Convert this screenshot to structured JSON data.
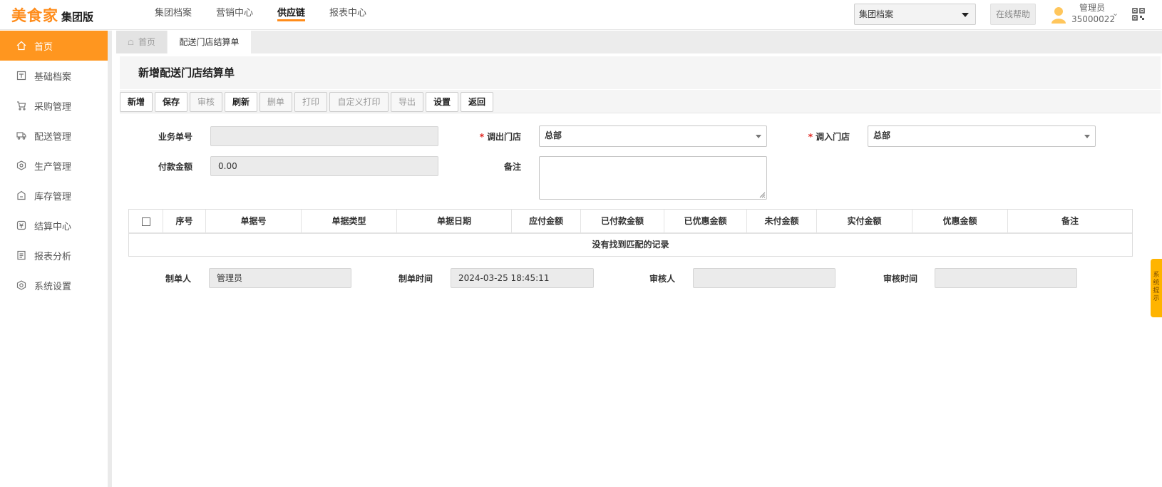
{
  "header": {
    "brand": "美食家",
    "edition": "集团版",
    "nav": [
      "集团档案",
      "营销中心",
      "供应链",
      "报表中心"
    ],
    "active_nav": "供应链",
    "org_select": "集团档案",
    "help": "在线帮助",
    "user_role": "管理员",
    "user_id": "35000022"
  },
  "sidebar": {
    "items": [
      {
        "label": "首页",
        "icon": "home-icon"
      },
      {
        "label": "基础档案",
        "icon": "archive-icon"
      },
      {
        "label": "采购管理",
        "icon": "cart-icon"
      },
      {
        "label": "配送管理",
        "icon": "truck-icon"
      },
      {
        "label": "生产管理",
        "icon": "production-icon"
      },
      {
        "label": "库存管理",
        "icon": "inventory-icon"
      },
      {
        "label": "结算中心",
        "icon": "settlement-icon"
      },
      {
        "label": "报表分析",
        "icon": "report-icon"
      },
      {
        "label": "系统设置",
        "icon": "settings-icon"
      }
    ],
    "active": "首页"
  },
  "tabs": {
    "home": "首页",
    "current": "配送门店结算单"
  },
  "page": {
    "title": "新增配送门店结算单",
    "toolbar": [
      "新增",
      "保存",
      "审核",
      "刷新",
      "删单",
      "打印",
      "自定义打印",
      "导出",
      "设置",
      "返回"
    ],
    "toolbar_disabled": [
      "审核",
      "删单",
      "打印",
      "自定义打印",
      "导出"
    ]
  },
  "form": {
    "doc_no_label": "业务单号",
    "doc_no_value": "",
    "out_store_label": "调出门店",
    "out_store_value": "总部",
    "in_store_label": "调入门店",
    "in_store_value": "总部",
    "pay_amount_label": "付款金额",
    "pay_amount_value": "0.00",
    "remark_label": "备注",
    "remark_value": ""
  },
  "table": {
    "columns": [
      "序号",
      "单据号",
      "单据类型",
      "单据日期",
      "应付金额",
      "已付款金额",
      "已优惠金额",
      "未付金额",
      "实付金额",
      "优惠金额",
      "备注"
    ],
    "empty_text": "没有找到匹配的记录"
  },
  "footer": {
    "creator_label": "制单人",
    "creator_value": "管理员",
    "created_time_label": "制单时间",
    "created_time_value": "2024-03-25 18:45:11",
    "auditor_label": "审核人",
    "auditor_value": "",
    "audit_time_label": "审核时间",
    "audit_time_value": ""
  },
  "sys_tip": "系统提示",
  "colors": {
    "accent": "#ff961f",
    "required": "#e0211b"
  }
}
